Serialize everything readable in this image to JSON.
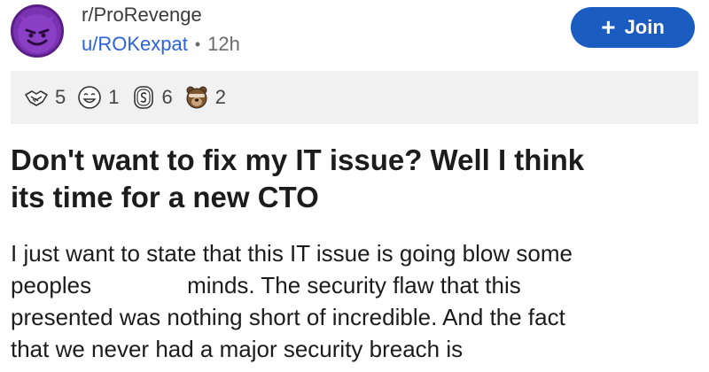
{
  "post": {
    "subreddit": "r/ProRevenge",
    "username": "u/ROKexpat",
    "separator": "•",
    "time_ago": "12h",
    "join_label": "Join",
    "join_icon": "plus-icon",
    "awards": [
      {
        "icon": "handshake-award-icon",
        "count": "5"
      },
      {
        "icon": "laughing-face-award-icon",
        "count": "1"
      },
      {
        "icon": "silver-coin-award-icon",
        "count": "6"
      },
      {
        "icon": "bear-award-icon",
        "count": "2"
      }
    ],
    "title_line1": "Don't want to fix my IT issue? Well I think",
    "title_line2": "its time for a new CTO",
    "body_line1": "I just want to state that this IT issue is going blow some",
    "body_line2a": "peoples",
    "body_line2b": "minds. The security flaw that this",
    "body_line3": "presented was nothing short of incredible. And the fact",
    "body_line4": "that we never had a major security breach is"
  },
  "colors": {
    "accent": "#1a5cc0",
    "username": "#2b63d9",
    "awards_bg": "#f1f1f1",
    "avatar": "#7a33b0"
  }
}
